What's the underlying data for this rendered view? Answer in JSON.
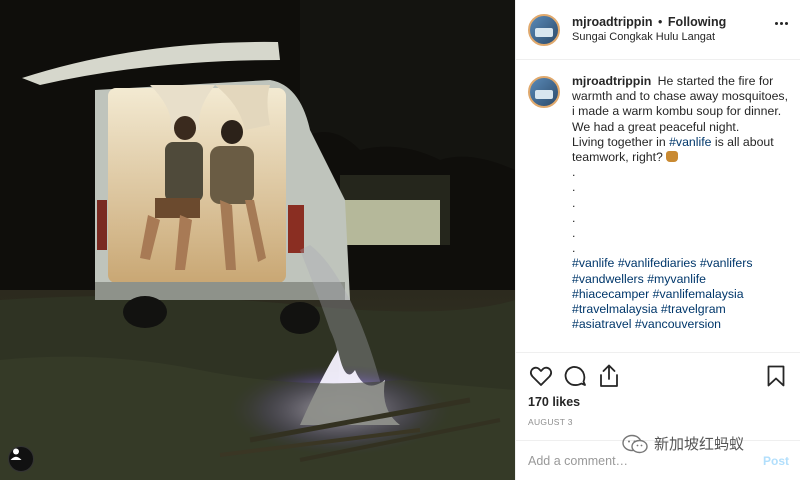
{
  "post": {
    "username": "mjroadtrippin",
    "dot": "•",
    "follow_status": "Following",
    "location": "Sungai Congkak Hulu Langat"
  },
  "caption": {
    "line1": "He started the fire for warmth and to chase away mosquitoes, i made a warm kombu soup for dinner. We had a great peaceful night.",
    "line2_before": "Living together in ",
    "line2_tag": "#vanlife",
    "line2_after": " is all about teamwork, right?",
    "dots": [
      ".",
      ".",
      ".",
      ".",
      ".",
      "."
    ],
    "hashtags": [
      [
        "#vanlife",
        "#vanlifediaries",
        "#vanlifers"
      ],
      [
        "#vandwellers",
        "#myvanlife"
      ],
      [
        "#hiacecamper",
        "#vanlifemalaysia"
      ],
      [
        "#travelmalaysia",
        "#travelgram"
      ],
      [
        "#asiatravel",
        "#vancouversion"
      ]
    ]
  },
  "engagement": {
    "likes": "170 likes",
    "date": "AUGUST 3"
  },
  "comment": {
    "placeholder": "Add a comment…",
    "post_label": "Post"
  },
  "watermark": {
    "text": "新加坡红蚂蚁"
  },
  "colors": {
    "hashtag": "#00376b",
    "post_disabled": "#b2dffc",
    "border": "#efefef"
  }
}
